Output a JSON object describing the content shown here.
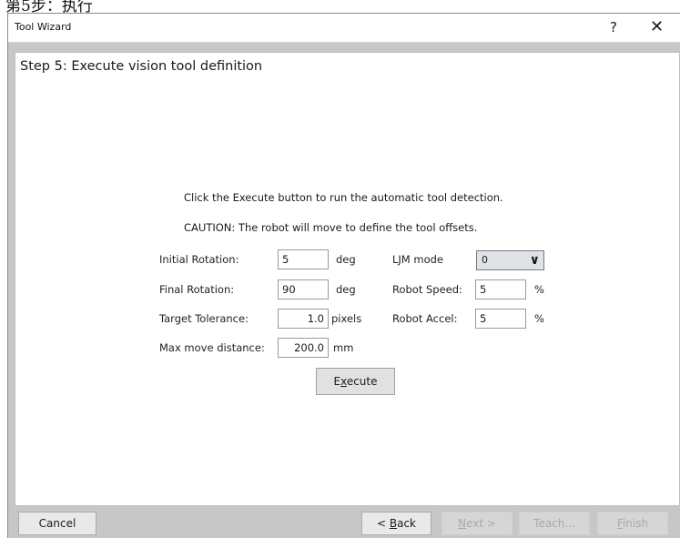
{
  "caption": "第5步：执行",
  "window": {
    "title": "Tool Wizard",
    "help": "?",
    "close": "✕"
  },
  "step_title": "Step 5: Execute vision tool definition",
  "instructions": {
    "line1": "Click the Execute button to run the automatic tool detection.",
    "line2": "CAUTION: The robot will move to define the tool offsets."
  },
  "fields": {
    "initial_rotation": {
      "label": "Initial Rotation:",
      "value": "5",
      "unit": "deg"
    },
    "final_rotation": {
      "label": "Final Rotation:",
      "value": "90",
      "unit": "deg"
    },
    "target_tolerance": {
      "label": "Target Tolerance:",
      "value": "1.0",
      "unit": "pixels"
    },
    "max_move_distance": {
      "label": "Max move distance:",
      "value": "200.0",
      "unit": "mm"
    },
    "ljm_mode": {
      "label": "LJM mode",
      "value": "0"
    },
    "robot_speed": {
      "label": "Robot Speed:",
      "value": "5",
      "unit": "%"
    },
    "robot_accel": {
      "label": "Robot Accel:",
      "value": "5",
      "unit": "%"
    }
  },
  "execute": {
    "pre": "E",
    "key": "x",
    "post": "ecute"
  },
  "buttons": {
    "cancel": "Cancel",
    "back": {
      "pre": "< ",
      "key": "B",
      "post": "ack"
    },
    "next": {
      "pre": "",
      "key": "N",
      "post": "ext >"
    },
    "teach": "Teach...",
    "finish": {
      "pre": "",
      "key": "F",
      "post": "inish"
    }
  }
}
